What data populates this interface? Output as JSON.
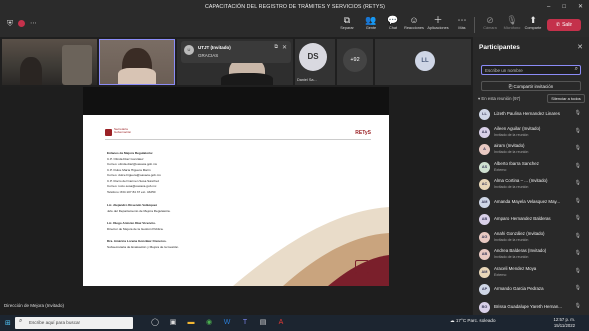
{
  "window": {
    "title": "CAPACITACIÓN DEL REGISTRO DE TRÁMITES Y SERVICIOS (RETYS)"
  },
  "toolbar": {
    "items": [
      {
        "label": "Separar",
        "icon": "separate-icon"
      },
      {
        "label": "Gente",
        "icon": "people-icon"
      },
      {
        "label": "Chat",
        "icon": "chat-icon"
      },
      {
        "label": "Reacciones",
        "icon": "reactions-icon"
      },
      {
        "label": "Aplicaciones",
        "icon": "apps-icon"
      },
      {
        "label": "Más",
        "icon": "more-icon"
      },
      {
        "label": "Cámara",
        "icon": "camera-off-icon"
      },
      {
        "label": "Micrófono",
        "icon": "mic-off-icon"
      },
      {
        "label": "Comparte",
        "icon": "share-icon"
      }
    ],
    "leave_label": "Salir",
    "accent": "#8b8cf7",
    "leave_color": "#c4314b"
  },
  "chat_popup": {
    "name": "UTJT (Invitado)",
    "message": "GRACIAS"
  },
  "gallery": {
    "ds_initials": "DS",
    "ds_name": "Daniel Sa...",
    "more_count": "+92",
    "ll_initials": "LL"
  },
  "slide": {
    "brand": "Secretaría\nGobernación",
    "retys": "RETyS",
    "lines": [
      {
        "text": "Enlaces de Mejora Regulatoria:",
        "bold": true
      },
      {
        "text": "C.P. Olinda Díaz González",
        "bold": false
      },
      {
        "text": "Correo: olinda.diaz@oaxaca.gob.mx",
        "bold": false
      },
      {
        "text": "C.P. Dulce María Higuera Marín",
        "bold": false
      },
      {
        "text": "Correo: dulce.higuera@oaxaca.gob.mx",
        "bold": false
      },
      {
        "text": "C.P. Rocío del Carmen Sosa Sánchez",
        "bold": false
      },
      {
        "text": "Correo: rocio.sosa@oaxaca.gob.mx",
        "bold": false
      },
      {
        "text": "Teléfono: 834 107 84 37 ext. 43250",
        "bold": false
      },
      {
        "text": "Lic. Alejandro Rosendo Velázquez",
        "bold": true
      },
      {
        "text": "Jefe del Departamento de Mejora Regulatoria.",
        "bold": false
      },
      {
        "text": "Lic. Diego Antonio Díaz Vicencio.",
        "bold": true
      },
      {
        "text": "Director de Mejora de la Gestión Pública.",
        "bold": false
      },
      {
        "text": "Dra. América Lorena González Cisneros.",
        "bold": true
      },
      {
        "text": "Subsecretaria de Evaluación y Mejora de la Gestión.",
        "bold": false
      }
    ]
  },
  "presenter_label": "Dirección de Mejora (Invitado)",
  "panel": {
    "title": "Participantes",
    "search_placeholder": "Escribe un nombre",
    "share_label": "Compartir invitación",
    "section_label": "En esta reunión (97)",
    "mute_all_label": "Silenciar a todos",
    "participants": [
      {
        "initials": "LL",
        "name": "Lizeth Paulina Hernandez Linares",
        "role": "",
        "color": "#cfd6e6"
      },
      {
        "initials": "AA",
        "name": "Aileen Aguilar (Invitado)",
        "role": "Invitado de la reunión",
        "color": "#d9d0e8"
      },
      {
        "initials": "A",
        "name": "airam (Invitado)",
        "role": "Invitado de la reunión",
        "color": "#e8c9c2"
      },
      {
        "initials": "AS",
        "name": "Alberto Ibarra Sanchez",
        "role": "Externo",
        "color": "#cfe0d0"
      },
      {
        "initials": "AC",
        "name": "Alma Cortina – ... (Invitado)",
        "role": "Invitado de la reunión",
        "color": "#e8d6b8"
      },
      {
        "initials": "AM",
        "name": "Amanda Mayela Velasquez May...",
        "role": "",
        "color": "#cfd6e6"
      },
      {
        "initials": "AB",
        "name": "Amparo Hernandez Balderas",
        "role": "",
        "color": "#d9d0e8"
      },
      {
        "initials": "AG",
        "name": "Anahi González (Invitado)",
        "role": "Invitado de la reunión",
        "color": "#e8c9c2"
      },
      {
        "initials": "AB",
        "name": "Andrea Balderas (Invitado)",
        "role": "Invitado de la reunión",
        "color": "#e8c9c2"
      },
      {
        "initials": "AM",
        "name": "Araceli Mendez Moya",
        "role": "Externo",
        "color": "#e8d6b8"
      },
      {
        "initials": "AP",
        "name": "Armando Garcia Pedraza",
        "role": "",
        "color": "#cfd6e6"
      },
      {
        "initials": "BG",
        "name": "Brissa Guadalupe Yareth Hernan...",
        "role": "",
        "color": "#d9d0e8"
      }
    ]
  },
  "taskbar": {
    "search_placeholder": "Escribe aquí para buscar",
    "weather": "17°C  Parc. soleado",
    "time": "12:57 p. m.",
    "date": "15/11/2022"
  }
}
